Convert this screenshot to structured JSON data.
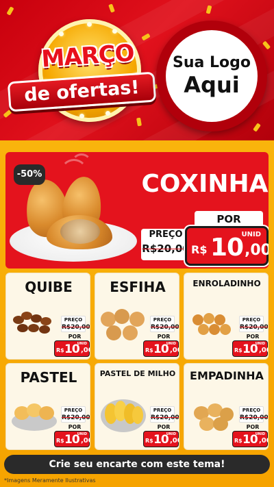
{
  "header": {
    "promo_line1": "MARÇO",
    "promo_line2": "de ofertas!",
    "logo_top": "Sua Logo",
    "logo_bottom": "Aqui"
  },
  "featured": {
    "discount": "-50%",
    "name": "COXINHA",
    "preco_label": "PREÇO",
    "old_price": "R$20,00",
    "por_label": "POR",
    "unid_label": "UNID",
    "currency": "R$",
    "price_int": "10",
    "price_dec": ",00"
  },
  "products": [
    {
      "name": "QUIBE",
      "preco_label": "PREÇO",
      "old_price": "R$20,00",
      "por_label": "POR",
      "unid_label": "UNID",
      "currency": "R$",
      "price_int": "10",
      "price_dec": ",00",
      "icon": "quibe-icon"
    },
    {
      "name": "ESFIHA",
      "preco_label": "PREÇO",
      "old_price": "R$20,00",
      "por_label": "POR",
      "unid_label": "UNID",
      "currency": "R$",
      "price_int": "10",
      "price_dec": ",00",
      "icon": "esfiha-icon"
    },
    {
      "name": "ENROLADINHO",
      "preco_label": "PREÇO",
      "old_price": "R$20,00",
      "por_label": "POR",
      "unid_label": "UNID",
      "currency": "R$",
      "price_int": "10",
      "price_dec": ",00",
      "icon": "enroladinho-icon"
    },
    {
      "name": "PASTEL",
      "preco_label": "PREÇO",
      "old_price": "R$20,00",
      "por_label": "POR",
      "unid_label": "UNID",
      "currency": "R$",
      "price_int": "10",
      "price_dec": ",00",
      "icon": "pastel-icon"
    },
    {
      "name": "PASTEL DE MILHO",
      "preco_label": "PREÇO",
      "old_price": "R$20,00",
      "por_label": "POR",
      "unid_label": "UNID",
      "currency": "R$",
      "price_int": "10",
      "price_dec": ",00",
      "icon": "pastel-de-milho-icon"
    },
    {
      "name": "EMPADINHA",
      "preco_label": "PREÇO",
      "old_price": "R$20,00",
      "por_label": "POR",
      "unid_label": "UNID",
      "currency": "R$",
      "price_int": "10",
      "price_dec": ",00",
      "icon": "empadinha-icon"
    }
  ],
  "footer": {
    "cta": "Crie seu encarte com este tema!",
    "disclaimer": "*Imagens Meramente Ilustrativas"
  },
  "colors": {
    "brand_red": "#e4131d",
    "accent_yellow": "#f9b40c",
    "dark": "#2a2a2a",
    "card_bg": "#fdf7e7"
  }
}
